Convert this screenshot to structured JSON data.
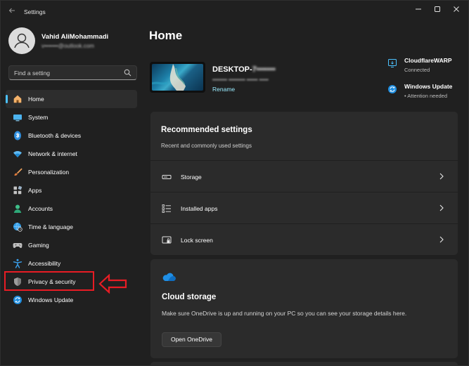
{
  "window": {
    "title": "Settings",
    "controls": [
      "minimize-icon",
      "maximize-icon",
      "close-icon"
    ]
  },
  "user": {
    "name": "Vahid AliMohammadi",
    "email": "v•••••••@outlook.com"
  },
  "search": {
    "placeholder": "Find a setting"
  },
  "sidebar": {
    "items": [
      {
        "label": "Home",
        "icon": "home-icon",
        "selected": true
      },
      {
        "label": "System",
        "icon": "monitor-icon"
      },
      {
        "label": "Bluetooth & devices",
        "icon": "bluetooth-icon"
      },
      {
        "label": "Network & internet",
        "icon": "wifi-icon"
      },
      {
        "label": "Personalization",
        "icon": "brush-icon"
      },
      {
        "label": "Apps",
        "icon": "apps-icon"
      },
      {
        "label": "Accounts",
        "icon": "person-icon"
      },
      {
        "label": "Time & language",
        "icon": "globe-clock-icon"
      },
      {
        "label": "Gaming",
        "icon": "gamepad-icon"
      },
      {
        "label": "Accessibility",
        "icon": "accessibility-icon"
      },
      {
        "label": "Privacy & security",
        "icon": "shield-icon"
      },
      {
        "label": "Windows Update",
        "icon": "update-icon"
      }
    ]
  },
  "main": {
    "title": "Home",
    "device": {
      "name_prefix": "DESKTOP-",
      "name_rest": "7•••••••",
      "model": "•••••••• ••••••••• •••••• •••••",
      "rename": "Rename"
    },
    "status": [
      {
        "title": "CloudflareWARP",
        "subtitle": "Connected",
        "icon": "vpn-icon"
      },
      {
        "title": "Windows Update",
        "subtitle": "Attention needed",
        "icon": "update-icon"
      }
    ],
    "recommended": {
      "title": "Recommended settings",
      "subtitle": "Recent and commonly used settings",
      "items": [
        {
          "label": "Storage",
          "icon": "storage-icon"
        },
        {
          "label": "Installed apps",
          "icon": "list-icon"
        },
        {
          "label": "Lock screen",
          "icon": "lock-screen-icon"
        }
      ]
    },
    "cloud": {
      "title": "Cloud storage",
      "description": "Make sure OneDrive is up and running on your PC so you can see your storage details here.",
      "button": "Open OneDrive"
    }
  },
  "colors": {
    "accent": "#4cc2ff",
    "background": "#202020",
    "card": "#2b2b2b",
    "annotation": "#e81c24"
  }
}
